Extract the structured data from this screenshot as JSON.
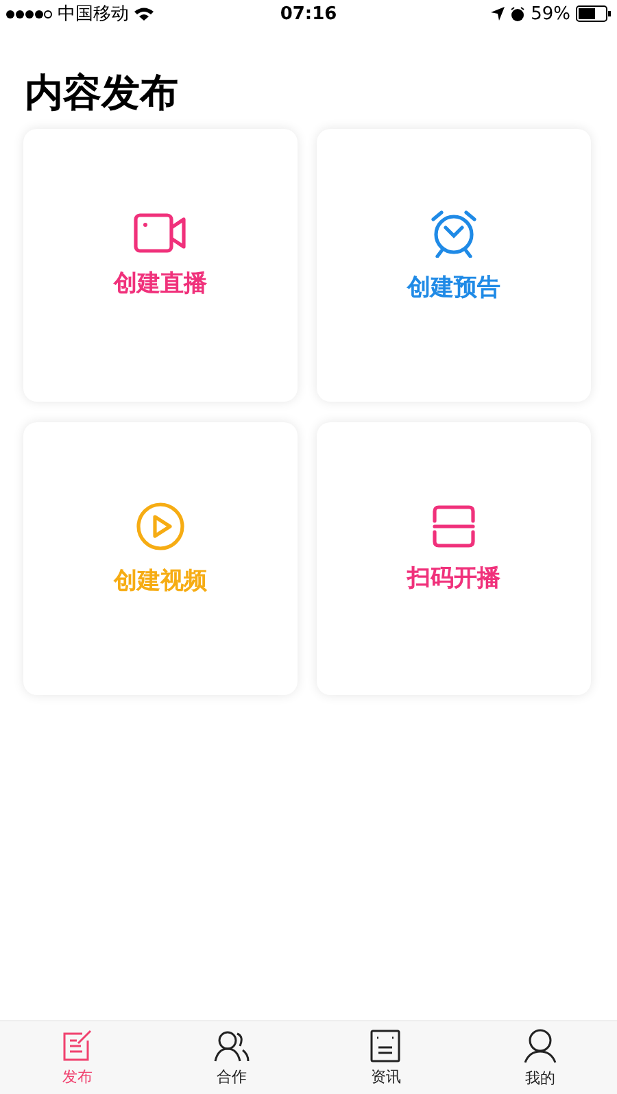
{
  "status_bar": {
    "carrier": "中国移动",
    "time": "07:16",
    "battery": "59%"
  },
  "title": "内容发布",
  "cards": [
    {
      "kind": "camera",
      "label": "创建直播",
      "color": "#f0317b"
    },
    {
      "kind": "alarm",
      "label": "创建预告",
      "color": "#1f8ae6"
    },
    {
      "kind": "play",
      "label": "创建视频",
      "color": "#f6ac13"
    },
    {
      "kind": "scan",
      "label": "扫码开播",
      "color": "#f0317b"
    }
  ],
  "tabs": [
    {
      "kind": "publish",
      "label": "发布",
      "selected": true
    },
    {
      "kind": "people",
      "label": "合作",
      "selected": false
    },
    {
      "kind": "news",
      "label": "资讯",
      "selected": false
    },
    {
      "kind": "person",
      "label": "我的",
      "selected": false
    }
  ]
}
